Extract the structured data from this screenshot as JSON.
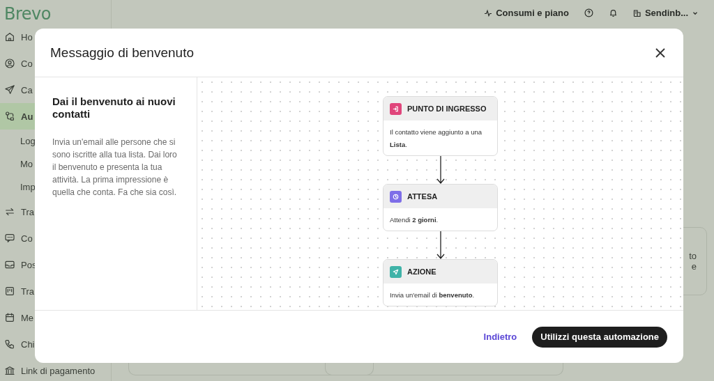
{
  "sidebar": {
    "logo": "Brevo",
    "items": [
      {
        "label": "Ho",
        "selected": false
      },
      {
        "label": "Co",
        "selected": false
      },
      {
        "label": "Ca",
        "selected": false
      },
      {
        "label": "Au",
        "selected": true,
        "children": [
          {
            "label": "Log"
          },
          {
            "label": "Mo"
          },
          {
            "label": "Imp"
          }
        ]
      },
      {
        "label": "Tra",
        "selected": false
      },
      {
        "label": "Co",
        "selected": false
      },
      {
        "label": "Pos",
        "selected": false
      },
      {
        "label": "Tra",
        "selected": false
      },
      {
        "label": "Me",
        "selected": false
      },
      {
        "label": "Chi",
        "selected": false
      },
      {
        "label": "Link di pagamento",
        "selected": false
      }
    ]
  },
  "top_bar": {
    "usage": "Consumi e piano",
    "account": "Sendinb..."
  },
  "background_card": {
    "lines": [
      "to",
      "e"
    ]
  },
  "modal": {
    "title": "Messaggio di benvenuto",
    "heading": "Dai il benvenuto ai nuovi contatti",
    "description": "Invia un'email alle persone che si sono iscritte alla tua lista. Dai loro il benvenuto e presenta la tua attività. La prima impressione è quella che conta. Fa che sia così.",
    "steps": [
      {
        "kind": "entry",
        "title": "PUNTO DI INGRESSO",
        "text": "Il contatto viene aggiunto a una **Lista**."
      },
      {
        "kind": "wait",
        "title": "ATTESA",
        "text": "Attendi **2 giorni**."
      },
      {
        "kind": "action",
        "title": "AZIONE",
        "text": "Invia un'email di **benvenuto**."
      }
    ],
    "buttons": [
      {
        "label": "Indietro",
        "kind": "link"
      },
      {
        "label": "Utilizzi questa automazione",
        "kind": "primary"
      }
    ]
  }
}
